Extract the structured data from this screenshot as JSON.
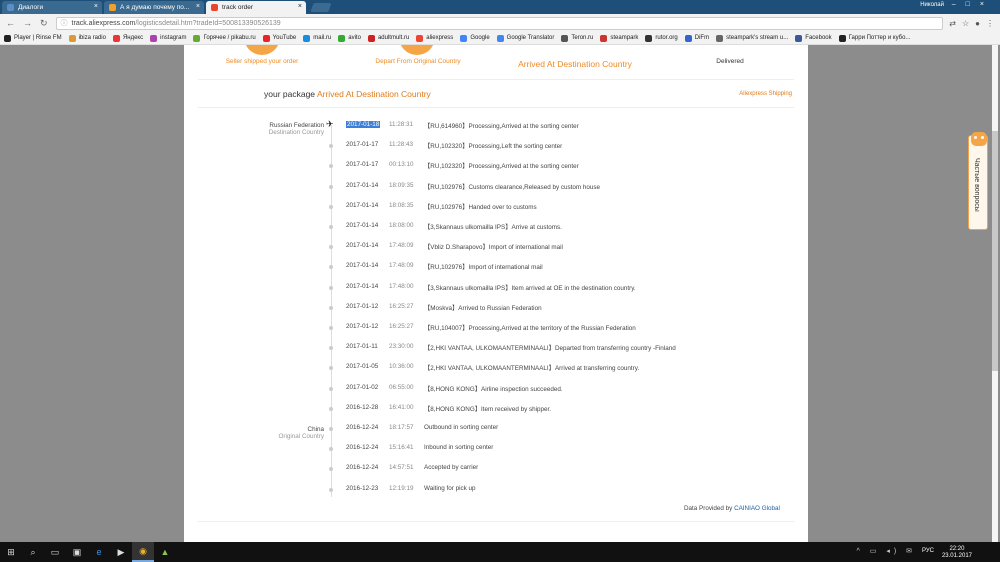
{
  "browser": {
    "tabs": [
      {
        "title": "Диалоги",
        "color": "#5b8fc7",
        "active": false
      },
      {
        "title": "А я думаю почему по...",
        "color": "#f0a030",
        "active": false
      },
      {
        "title": "track order",
        "color": "#e8452c",
        "active": true
      }
    ],
    "user": "Николай",
    "url_host": "track.aliexpress.com",
    "url_path": "/logisticsdetail.htm?tradeId=500813390526139",
    "bookmarks": [
      {
        "label": "Player | Rinse FM",
        "color": "#222"
      },
      {
        "label": "ibiza radio",
        "color": "#d93"
      },
      {
        "label": "Яндекс",
        "color": "#e33"
      },
      {
        "label": "instagram",
        "color": "#a4a"
      },
      {
        "label": "Горячее / pikabu.ru",
        "color": "#6a3"
      },
      {
        "label": "YouTube",
        "color": "#e22"
      },
      {
        "label": "mail.ru",
        "color": "#168de2"
      },
      {
        "label": "avito",
        "color": "#3a3"
      },
      {
        "label": "adultmult.ru",
        "color": "#c22"
      },
      {
        "label": "aliexpress",
        "color": "#e43"
      },
      {
        "label": "Google",
        "color": "#4285f4"
      },
      {
        "label": "Google Translator",
        "color": "#4285f4"
      },
      {
        "label": "Teron.ru",
        "color": "#555"
      },
      {
        "label": "steampark",
        "color": "#c33"
      },
      {
        "label": "rutor.org",
        "color": "#333"
      },
      {
        "label": "DiFm",
        "color": "#36c"
      },
      {
        "label": "steampark's stream u...",
        "color": "#666"
      },
      {
        "label": "Facebook",
        "color": "#3b5998"
      },
      {
        "label": "Гарри Поттер и кубо...",
        "color": "#222"
      }
    ]
  },
  "steps": {
    "s1": "Seller shipped your order",
    "s2": "Depart From Original Country",
    "s3": "Arrived At Destination Country",
    "s4": "Delivered"
  },
  "header": {
    "prefix": "your package ",
    "status": "Arrived At Destination Country",
    "shipping": "Aliexpress Shipping"
  },
  "destination": {
    "name": "Russian Federation",
    "sub": "Destination Country"
  },
  "origin": {
    "name": "China",
    "sub": "Original Country"
  },
  "events": [
    {
      "date": "2017-01-18",
      "time": "11:28:31",
      "desc": "【RU,614960】Processing,Arrived at the sorting center"
    },
    {
      "date": "2017-01-17",
      "time": "11:28:43",
      "desc": "【RU,102320】Processing,Left the sorting center"
    },
    {
      "date": "2017-01-17",
      "time": "00:13:10",
      "desc": "【RU,102320】Processing,Arrived at the sorting center"
    },
    {
      "date": "2017-01-14",
      "time": "18:09:35",
      "desc": "【RU,102976】Customs clearance,Released by custom house"
    },
    {
      "date": "2017-01-14",
      "time": "18:08:35",
      "desc": "【RU,102976】Handed over to customs"
    },
    {
      "date": "2017-01-14",
      "time": "18:08:00",
      "desc": "【3,Skannaus ulkomailla IPS】Arrive at customs."
    },
    {
      "date": "2017-01-14",
      "time": "17:48:09",
      "desc": "【Vbliz D.Sharapovo】Import of international mail"
    },
    {
      "date": "2017-01-14",
      "time": "17:48:09",
      "desc": "【RU,102976】Import of international mail"
    },
    {
      "date": "2017-01-14",
      "time": "17:48:00",
      "desc": "【3,Skannaus ulkomailla IPS】Item arrived at OE in the destination country."
    },
    {
      "date": "2017-01-12",
      "time": "16:25:27",
      "desc": "【Moskva】Arrived to Russian Federation"
    },
    {
      "date": "2017-01-12",
      "time": "16:25:27",
      "desc": "【RU,104007】Processing,Arrived at the territory of the Russian Federation"
    },
    {
      "date": "2017-01-11",
      "time": "23:30:00",
      "desc": "【2,HKI VANTAA, ULKOMAANTERMINAALI】Departed from transferring country -Finland"
    },
    {
      "date": "2017-01-05",
      "time": "10:36:00",
      "desc": "【2,HKI VANTAA, ULKOMAANTERMINAALI】Arrived at transferring country."
    },
    {
      "date": "2017-01-02",
      "time": "06:55:00",
      "desc": "【8,HONG KONG】Airline inspection succeeded."
    },
    {
      "date": "2016-12-28",
      "time": "16:41:00",
      "desc": "【8,HONG KONG】Item received by shipper."
    },
    {
      "date": "2016-12-24",
      "time": "18:17:57",
      "desc": "Outbound in sorting center"
    },
    {
      "date": "2016-12-24",
      "time": "15:16:41",
      "desc": "Inbound in sorting center"
    },
    {
      "date": "2016-12-24",
      "time": "14:57:51",
      "desc": "Accepted by carrier"
    },
    {
      "date": "2016-12-23",
      "time": "12:19:19",
      "desc": "Waiting for pick up"
    }
  ],
  "provided": {
    "prefix": "Data Provided by ",
    "brand": "CAINIAO Global"
  },
  "faq": {
    "label": "Частые вопросы"
  },
  "taskbar": {
    "lang": "РУС",
    "time": "22:20",
    "date": "23.01.2017"
  },
  "colors": {
    "accent": "#f08a24",
    "link": "#1b5fa8"
  }
}
